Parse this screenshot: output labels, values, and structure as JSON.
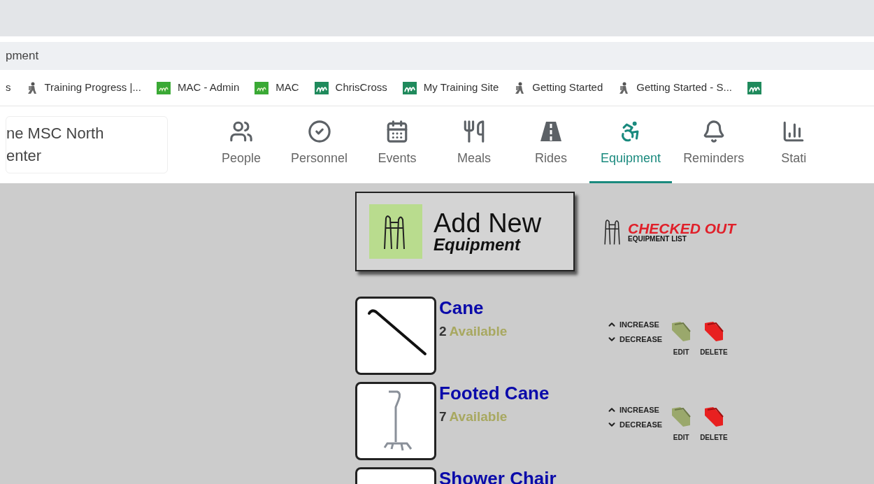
{
  "window": {
    "title": "pment"
  },
  "bookmarks": [
    {
      "label": "s",
      "kind": "none"
    },
    {
      "label": "Training Progress |...",
      "kind": "hiker"
    },
    {
      "label": "MAC - Admin",
      "kind": "my"
    },
    {
      "label": "MAC",
      "kind": "my"
    },
    {
      "label": "ChrisCross",
      "kind": "m"
    },
    {
      "label": "My Training Site",
      "kind": "m"
    },
    {
      "label": "Getting Started",
      "kind": "hiker"
    },
    {
      "label": "Getting Started - S...",
      "kind": "hiker"
    },
    {
      "kind": "m"
    }
  ],
  "org": {
    "lines": [
      "ne MSC North",
      "enter"
    ]
  },
  "nav": [
    {
      "label": "People",
      "kind": "people",
      "selected": false
    },
    {
      "label": "Personnel",
      "kind": "check",
      "selected": false
    },
    {
      "label": "Events",
      "kind": "calendar",
      "selected": false
    },
    {
      "label": "Meals",
      "kind": "meals",
      "selected": false
    },
    {
      "label": "Rides",
      "kind": "road",
      "selected": false
    },
    {
      "label": "Equipment",
      "kind": "wheelchair",
      "selected": true
    },
    {
      "label": "Reminders",
      "kind": "bell",
      "selected": false
    },
    {
      "label": "Stati",
      "kind": "chart",
      "selected": false
    }
  ],
  "add_button": {
    "line1": "Add New",
    "line2": "Equipment"
  },
  "checked_out": {
    "title": "CHECKED OUT",
    "subtitle": "EQUIPMENT LIST"
  },
  "items": [
    {
      "name": "Cane",
      "count": "2",
      "status": "Available",
      "kind": "cane",
      "increase": "INCREASE",
      "decrease": "DECREASE",
      "edit": "EDIT",
      "delete": "DELETE"
    },
    {
      "name": "Footed Cane",
      "count": "7",
      "status": "Available",
      "kind": "footed",
      "increase": "INCREASE",
      "decrease": "DECREASE",
      "edit": "EDIT",
      "delete": "DELETE"
    },
    {
      "name": "Shower Chair",
      "kind": "chair"
    }
  ]
}
